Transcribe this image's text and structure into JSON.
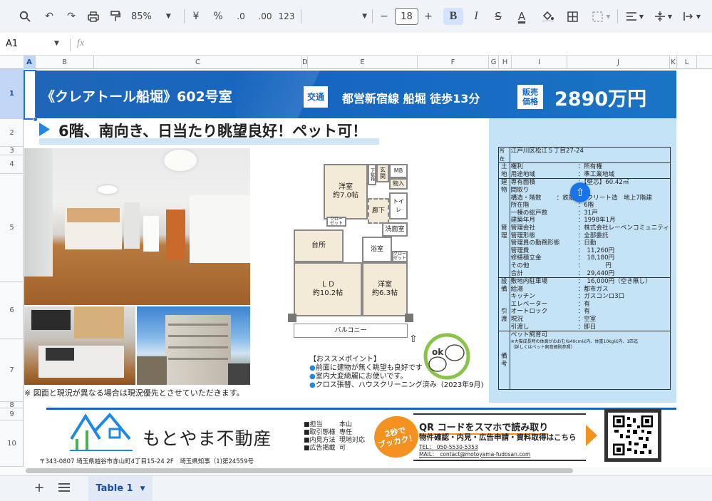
{
  "toolbar": {
    "zoom": "85%",
    "currency": "¥",
    "percent": "%",
    "dec_decrease": ".0",
    "dec_increase": ".00",
    "number_format": "123",
    "font_size": "18",
    "bold": "B",
    "italic": "I",
    "strike": "S",
    "text_color": "A"
  },
  "formula_bar": {
    "cell_ref": "A1",
    "fx": "fx"
  },
  "columns": [
    "A",
    "B",
    "C",
    "D",
    "E",
    "F",
    "G",
    "H",
    "I",
    "J",
    "K",
    "L"
  ],
  "rows": [
    "1",
    "2",
    "3",
    "4",
    "5",
    "6",
    "7",
    "8",
    "9",
    "10"
  ],
  "listing": {
    "title": "《クレアトール船堀》602号室",
    "transport_label": "交通",
    "transport": "都営新宿線 船堀 徒歩13分",
    "price_label": "販売\n価格",
    "price": "2890万円",
    "headline": "6階、南向き、日当たり眺望良好！ペット可！",
    "note": "※ 図面と現況が異なる場合は現況優先とさせていただきます。"
  },
  "floorplan": {
    "rooms": [
      "洋室\n約7.0帖",
      "玄関",
      "MB",
      "物入",
      "下駄箱",
      "クロー\nゼット",
      "廊下",
      "トイレ",
      "洗面室",
      "台所",
      "浴室",
      "クロー\nゼット",
      "ＬＤ\n約10.2帖",
      "洋室\n約6.3帖"
    ],
    "balcony": "バルコニー"
  },
  "recommend": {
    "heading": "【おススメポイント】",
    "points": [
      "前面に建物が無く眺望も良好です",
      "室内大変綺麗にお使いです。",
      "クロス張替、ハウスクリーニング済み（2023年9月)"
    ]
  },
  "info": {
    "address_label": "所在",
    "address": "江戸川区松江５丁目27-24",
    "land_label": "土\n地",
    "land": [
      [
        "権利",
        "：所有権"
      ],
      [
        "用途地域",
        "：準工業地域"
      ]
    ],
    "bldg_label": "建\n物\n\n\n\n\n管\n理",
    "bldg": [
      [
        "専有面積",
        "：【壁芯】60.42㎡"
      ],
      [
        "間取り",
        "："
      ],
      [
        "構造・階数",
        "：鉄筋コンクリート造　地上7階建"
      ],
      [
        "所在階",
        "：6階"
      ],
      [
        "一棟の総戸数",
        "：31戸"
      ],
      [
        "建築年月",
        "：1998年1月"
      ],
      [
        "管理会社",
        "：株式会社レーベンコミュニティ"
      ],
      [
        "管理形態",
        "：全部委託"
      ],
      [
        "管理員の勤務形態",
        "：日勤"
      ],
      [
        "管理費",
        "：　11,260円"
      ],
      [
        "修繕積立金",
        "：　18,180円"
      ],
      [
        "その他",
        "：　　　　円"
      ],
      [
        "合計",
        "：　29,440円"
      ]
    ],
    "equip_label": "設\n備\n\n\n引\n渡",
    "equip": [
      [
        "敷地内駐車場",
        "：　16,000円（空き無し）"
      ],
      [
        "給湯",
        "：都市ガス"
      ],
      [
        "キッチン",
        "：ガスコンロ3口"
      ],
      [
        "エレベーター",
        "：有"
      ],
      [
        "オートロック",
        "：有"
      ],
      [
        "現況",
        "：空室"
      ],
      [
        "引渡し",
        "：即日"
      ]
    ],
    "remarks_label": "備\n考",
    "pet": "ペット飼育可",
    "pet_note": "※大猫成長時の体高がおおむね40cm以内、体重10kg以内、1匹迄\n（詳しくはペット飼育細則参照）"
  },
  "company": {
    "name": "もとやま不動産",
    "address": "〒343-0807 埼玉県越谷市赤山町4丁目15-24 2F　埼玉県知事（1)第24559号",
    "details": [
      [
        "■担当",
        "本山"
      ],
      [
        "■取引態様",
        "専任"
      ],
      [
        "■内見方法",
        "現地対応"
      ],
      [
        "■広告掲載",
        "可"
      ]
    ],
    "badge": "2秒で\nブッカク！",
    "qr_title": "QR コードをスマホで読み取り",
    "qr_sub": "物件確認・内見・広告申請・資料取得はこちら",
    "tel": "TEL：　050-5530-5353",
    "mail": "MAIL：　contact@motoyama-fudosan.com"
  },
  "tabs": {
    "sheet": "Table 1"
  },
  "colors": {
    "banner": "#1565c0",
    "panel": "#c5e3f7",
    "badge": "#f39221",
    "headline_arrow": "#1e88e5"
  }
}
